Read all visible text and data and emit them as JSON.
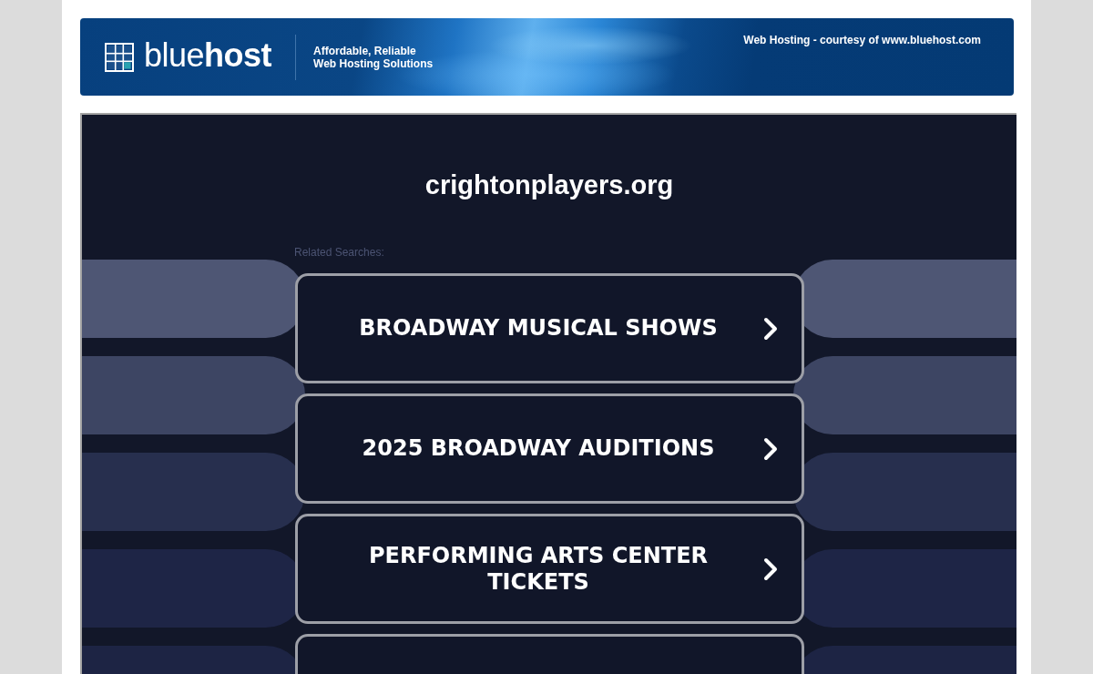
{
  "banner": {
    "logo_text": "blue**host**",
    "tagline": "Affordable, Reliable Web Hosting Solutions",
    "courtesy": "Web Hosting - courtesy of www.bluehost.com"
  },
  "parked_page": {
    "domain": "crightonplayers.org",
    "related_label": "Related Searches:",
    "searches": [
      {
        "label": "BROADWAY MUSICAL SHOWS"
      },
      {
        "label": "2025 BROADWAY AUDITIONS"
      },
      {
        "label": "PERFORMING ARTS CENTER TICKETS"
      }
    ],
    "more_below": true
  }
}
